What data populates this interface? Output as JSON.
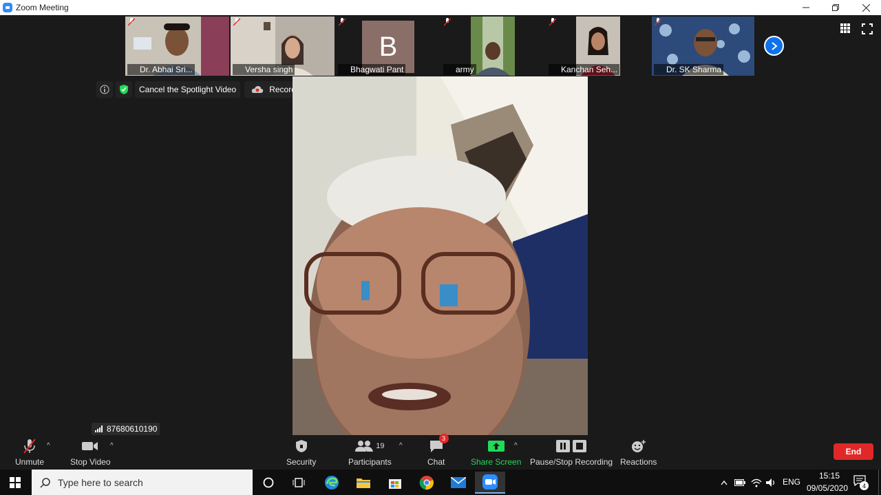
{
  "window": {
    "title": "Zoom Meeting",
    "controls": [
      "minimize",
      "restore",
      "close"
    ]
  },
  "participants_strip": [
    {
      "name": "Dr. Abhai Sri...",
      "muted": true
    },
    {
      "name": "Versha singh",
      "muted": true
    },
    {
      "name": "Bhagwati Pant",
      "muted": true,
      "avatar_letter": "B"
    },
    {
      "name": "army",
      "muted": true
    },
    {
      "name": "Kanchan Seh...",
      "muted": true
    },
    {
      "name": "Dr. SK Sharma",
      "muted": true
    }
  ],
  "info_bar": {
    "spotlight_label": "Cancel the Spotlight Video",
    "recording_label": "Recording..."
  },
  "connection": {
    "phone_number": "87680610190"
  },
  "toolbar": {
    "unmute": "Unmute",
    "stop_video": "Stop Video",
    "security": "Security",
    "participants": "Participants",
    "participants_count": "19",
    "chat": "Chat",
    "chat_badge": "3",
    "share_screen": "Share Screen",
    "pause_stop_recording": "Pause/Stop Recording",
    "reactions": "Reactions",
    "end": "End"
  },
  "taskbar": {
    "search_placeholder": "Type here to search",
    "language": "ENG",
    "time": "15:15",
    "date": "09/05/2020",
    "notification_count": "4"
  },
  "colors": {
    "accent_blue": "#0e72ed",
    "end_red": "#e02828",
    "share_green": "#23d959"
  }
}
